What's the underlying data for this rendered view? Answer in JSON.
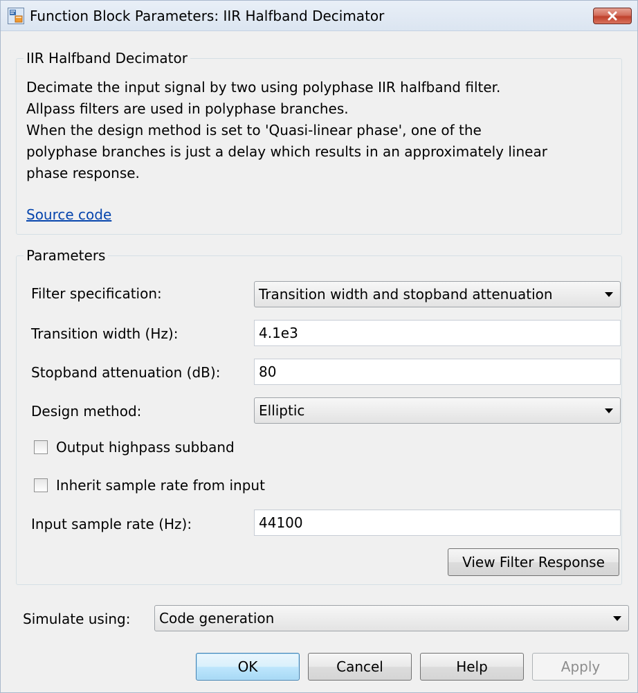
{
  "window": {
    "title": "Function Block Parameters: IIR Halfband Decimator",
    "close_icon": "close-x-icon"
  },
  "block_group": {
    "legend": "IIR Halfband Decimator",
    "description": [
      "Decimate the input signal by two using polyphase IIR halfband filter.",
      "Allpass filters are used in polyphase branches.",
      "When the design method is set to 'Quasi-linear phase', one of the",
      "polyphase branches is just a delay which results in an approximately linear",
      "phase response."
    ],
    "source_link": "Source code"
  },
  "parameters": {
    "legend": "Parameters",
    "filter_spec_label": "Filter specification:",
    "filter_spec_value": "Transition width and stopband attenuation",
    "transition_width_label": "Transition width (Hz):",
    "transition_width_value": "4.1e3",
    "stopband_label": "Stopband attenuation (dB):",
    "stopband_value": "80",
    "design_method_label": "Design method:",
    "design_method_value": "Elliptic",
    "output_highpass_label": "Output highpass subband",
    "output_highpass_checked": false,
    "inherit_rate_label": "Inherit sample rate from input",
    "inherit_rate_checked": false,
    "input_rate_label": "Input sample rate (Hz):",
    "input_rate_value": "44100",
    "view_response_label": "View Filter Response"
  },
  "simulate": {
    "label": "Simulate using:",
    "value": "Code generation"
  },
  "buttons": {
    "ok": "OK",
    "cancel": "Cancel",
    "help": "Help",
    "apply": "Apply"
  },
  "colors": {
    "link": "#0645ad",
    "close_button": "#c7422d",
    "default_button_border": "#3c7fb1"
  }
}
